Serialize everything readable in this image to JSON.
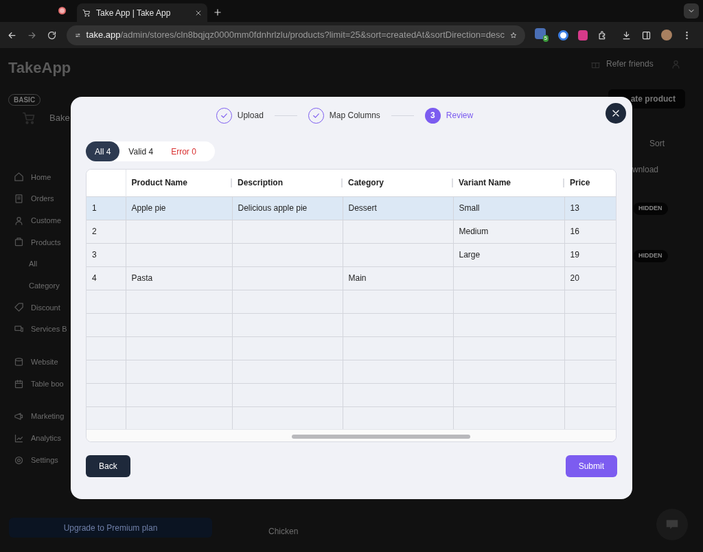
{
  "browser": {
    "tab_title": "Take App | Take App",
    "url_host": "take.app",
    "url_path": "/admin/stores/cln8bqjqz0000mm0fdnhrlzlu/products?limit=25&sort=createdAt&sortDirection=desc",
    "extension_badge": "5"
  },
  "background": {
    "logo": "TakeApp",
    "plan_badge": "BASIC",
    "store_name": "Bake",
    "refer": "Refer friends",
    "create_button": "ate product",
    "sort": "Sort",
    "download": "wnload",
    "hidden_badges": [
      "HIDDEN",
      "HIDDEN"
    ],
    "product_peek": "Chicken",
    "upgrade": "Upgrade to Premium plan",
    "nav": [
      {
        "label": "Home",
        "kind": "home"
      },
      {
        "label": "Orders",
        "kind": "orders"
      },
      {
        "label": "Custome",
        "kind": "customers"
      },
      {
        "label": "Products",
        "kind": "products"
      },
      {
        "label": "All",
        "kind": "sub"
      },
      {
        "label": "Category",
        "kind": "sub"
      },
      {
        "label": "Discount",
        "kind": "discounts"
      },
      {
        "label": "Services B",
        "kind": "services",
        "gap_after": true
      },
      {
        "label": "Website",
        "kind": "website"
      },
      {
        "label": "Table boo",
        "kind": "table",
        "gap_after": true
      },
      {
        "label": "Marketing",
        "kind": "marketing"
      },
      {
        "label": "Analytics",
        "kind": "analytics"
      },
      {
        "label": "Settings",
        "kind": "settings"
      }
    ]
  },
  "modal": {
    "steps": [
      {
        "label": "Upload",
        "kind": "done"
      },
      {
        "label": "Map Columns",
        "kind": "done"
      },
      {
        "label": "Review",
        "number": "3",
        "kind": "current"
      }
    ],
    "filters": [
      {
        "label": "All 4",
        "selected": true,
        "kind": "all"
      },
      {
        "label": "Valid 4",
        "selected": false,
        "kind": "valid"
      },
      {
        "label": "Error 0",
        "selected": false,
        "kind": "error"
      }
    ],
    "table": {
      "columns": [
        "Product Name",
        "Description",
        "Category",
        "Variant Name",
        "Price"
      ],
      "rows": [
        {
          "index": "1",
          "selected": true,
          "cells": [
            "Apple pie",
            "Delicious apple pie",
            "Dessert",
            "Small",
            "13"
          ]
        },
        {
          "index": "2",
          "selected": false,
          "cells": [
            null,
            null,
            null,
            "Medium",
            "16"
          ]
        },
        {
          "index": "3",
          "selected": false,
          "cells": [
            null,
            null,
            null,
            "Large",
            "19"
          ]
        },
        {
          "index": "4",
          "selected": false,
          "cells": [
            "Pasta",
            null,
            "Main",
            null,
            "20"
          ]
        }
      ]
    },
    "back_button": "Back",
    "submit_button": "Submit"
  }
}
